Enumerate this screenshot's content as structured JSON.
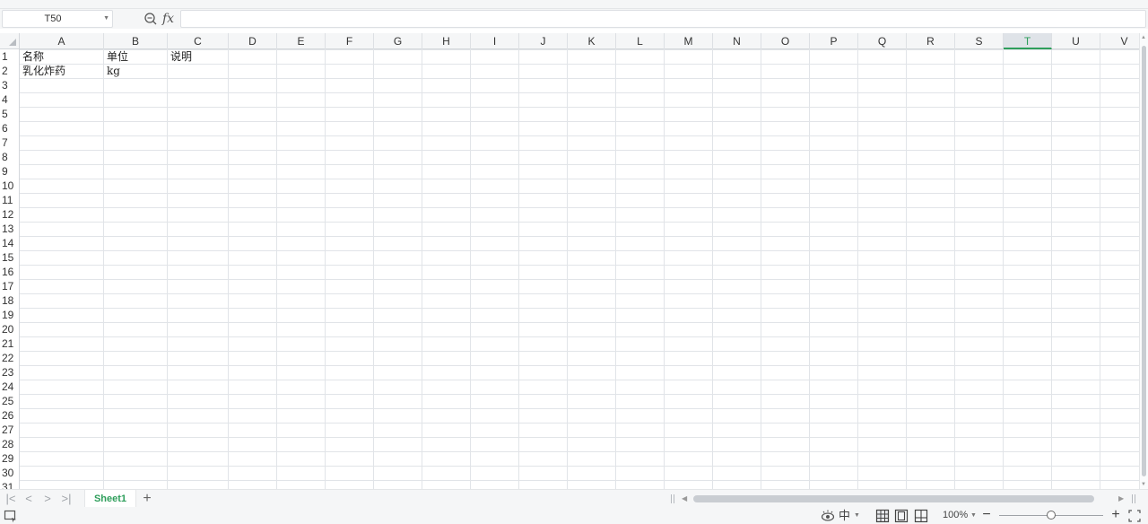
{
  "formula_bar": {
    "name_box": "T50",
    "fx_label": "fx",
    "formula": ""
  },
  "grid": {
    "columns": [
      "A",
      "B",
      "C",
      "D",
      "E",
      "F",
      "G",
      "H",
      "I",
      "J",
      "K",
      "L",
      "M",
      "N",
      "O",
      "P",
      "Q",
      "R",
      "S",
      "T",
      "U",
      "V"
    ],
    "active_column": "T",
    "rows": [
      "1",
      "2",
      "3",
      "4",
      "5",
      "6",
      "7",
      "8",
      "9",
      "10",
      "11",
      "12",
      "13",
      "14",
      "15",
      "16",
      "17",
      "18",
      "19",
      "20",
      "21",
      "22",
      "23",
      "24",
      "25",
      "26",
      "27",
      "28",
      "29",
      "30",
      "31"
    ],
    "cells": [
      [
        "名称",
        "单位",
        "说明"
      ],
      [
        "乳化炸药",
        "kg",
        ""
      ]
    ]
  },
  "sheets": {
    "tabs": [
      "Sheet1"
    ],
    "add_label": "+"
  },
  "status": {
    "ime": "中",
    "zoom": "100%",
    "zoom_level_percent": 100
  },
  "colors": {
    "accent": "#2e9e5b",
    "gridline": "#e1e4e8",
    "header_bg": "#f5f6f7"
  }
}
